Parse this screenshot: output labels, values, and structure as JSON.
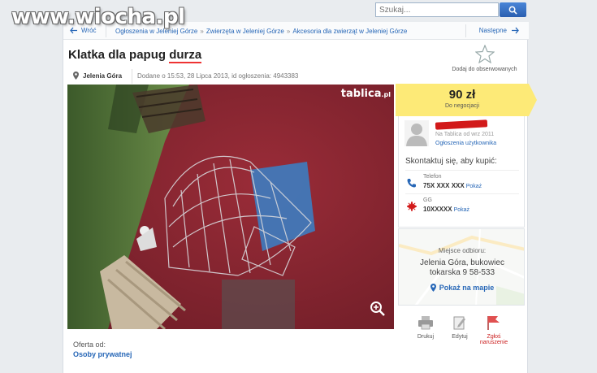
{
  "watermark": "www.wiocha.pl",
  "search": {
    "placeholder": "Szukaj..."
  },
  "nav": {
    "back": "Wróć",
    "breadcrumbs": [
      "Ogłoszenia w Jeleniej Górze",
      "Zwierzęta w Jeleniej Górze",
      "Akcesoria dla zwierząt w Jeleniej Górze"
    ],
    "next": "Następne"
  },
  "listing": {
    "title_prefix": "Klatka dla papug ",
    "title_highlight": "durza",
    "location": "Jelenia Góra",
    "added": "Dodane o 15:53, 28 Lipca 2013, id ogłoszenia: 4943383",
    "observe": "Dodaj do obserwowanych",
    "photo_logo": "tablica",
    "photo_logo_suffix": ".pl",
    "offer_label": "Oferta od:",
    "offer_who": "Osoby prywatnej"
  },
  "price": {
    "amount": "90 zł",
    "note": "Do negocjacji"
  },
  "seller": {
    "since": "Na Tablica od wrz 2011",
    "ads": "Ogłoszenia użytkownika",
    "contact": "Skontaktuj się, aby kupić:",
    "phone_label": "Telefon",
    "phone_value": "75X XXX XXX",
    "gg_label": "GG",
    "gg_value": "10XXXXX",
    "show": "Pokaż"
  },
  "map": {
    "pickup": "Miejsce odbioru:",
    "address_line1": "Jelenia Góra, bukowiec",
    "address_line2": "tokarska 9 58-533",
    "show_map": "Pokaż na mapie"
  },
  "actions": {
    "print": "Drukuj",
    "edit": "Edytuj",
    "report_line1": "Zgłoś",
    "report_line2": "naruszenie"
  },
  "colors": {
    "link": "#2767b7",
    "price_bg": "#fdea77",
    "photo_bg": "#8b2330",
    "highlight_underline": "#e33333"
  }
}
